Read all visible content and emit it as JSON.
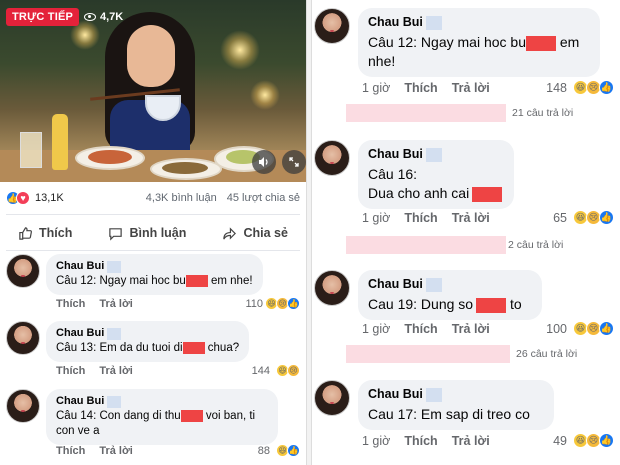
{
  "live": {
    "badge": "TRỰC TIẾP",
    "views": "4,7K"
  },
  "post_stats": {
    "reactions": "13,1K",
    "comments": "4,3K bình luận",
    "shares": "45 lượt chia sẻ"
  },
  "actions": {
    "like": "Thích",
    "comment": "Bình luận",
    "share": "Chia sẻ"
  },
  "colors": {
    "live_red": "#e4223a",
    "like_blue": "#1877f2",
    "redaction_red": "#ee4444",
    "bubble_gray": "#f0f2f5"
  },
  "left_comments": [
    {
      "author": "Chau Bui",
      "line1_pre": "Câu 12: Ngay mai hoc bu",
      "line1_post": " em nhe!",
      "line2": "",
      "time": "",
      "like": "Thích",
      "reply": "Trả lời",
      "count": "110"
    },
    {
      "author": "Chau Bui",
      "line1_pre": "Câu 13: Em da du tuoi di",
      "line1_post": " chua?",
      "line2": "",
      "time": "",
      "like": "Thích",
      "reply": "Trả lời",
      "count": "144"
    },
    {
      "author": "Chau Bui",
      "line1_pre": "Câu 14: Con dang di thu",
      "line1_post": " voi ban, ti",
      "line2": "con ve a",
      "time": "",
      "like": "Thích",
      "reply": "Trả lời",
      "count": "88"
    }
  ],
  "right_comments": [
    {
      "author": "Chau Bui",
      "line1_pre": "Câu 12: Ngay mai hoc bu",
      "line1_post": " em",
      "line2": "nhe!",
      "time": "1 giờ",
      "like": "Thích",
      "reply": "Trả lời",
      "count": "148",
      "replies": "21 câu trả lời"
    },
    {
      "author": "Chau Bui",
      "line1_pre": "Câu 16:",
      "line1_post": "",
      "line2_pre": "Dua cho anh cai",
      "time": "1 giờ",
      "like": "Thích",
      "reply": "Trả lời",
      "count": "65",
      "replies": "2 câu trả lời"
    },
    {
      "author": "Chau Bui",
      "line1_pre": "Cau 19: Dung so",
      "line1_post": " to",
      "time": "1 giờ",
      "like": "Thích",
      "reply": "Trả lời",
      "count": "100",
      "replies": "26 câu trả lời"
    },
    {
      "author": "Chau Bui",
      "line1_pre": "Cau 17: Em sap di treo co",
      "time": "1 giờ",
      "like": "Thích",
      "reply": "Trả lời",
      "count": "49"
    }
  ]
}
